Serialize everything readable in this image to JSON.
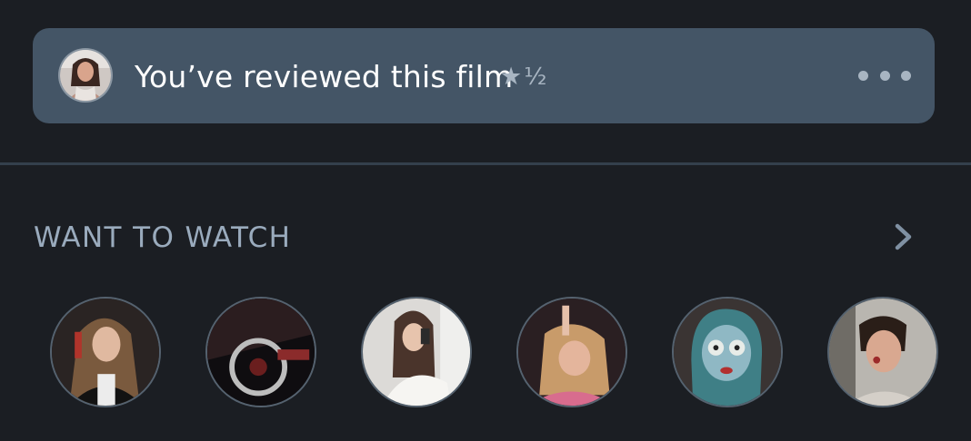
{
  "review_banner": {
    "text": "You’ve reviewed this film",
    "rating_star": "★",
    "rating_half": "½",
    "more_icon": "ellipsis-horizontal-icon"
  },
  "want_to_watch": {
    "title": "WANT TO WATCH",
    "chevron_icon": "chevron-right-icon",
    "friends_count_visible": 6
  },
  "colors": {
    "background": "#1b1e23",
    "card": "#445566",
    "text_primary": "#ffffff",
    "text_muted": "#9aabbd",
    "divider": "#34404c"
  }
}
